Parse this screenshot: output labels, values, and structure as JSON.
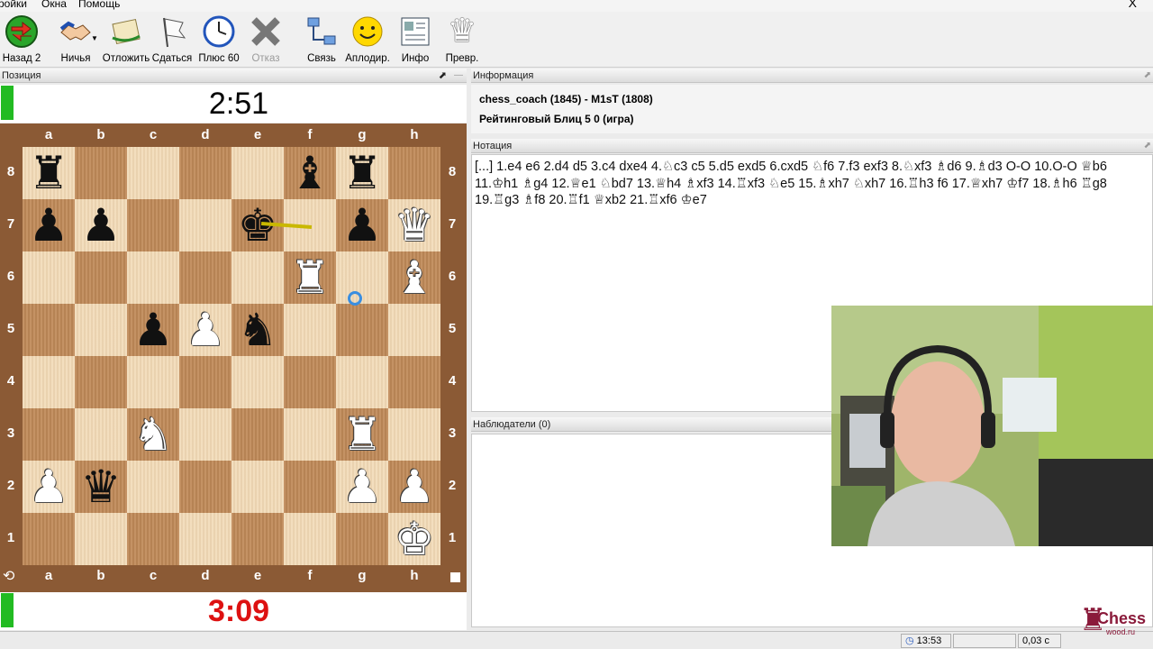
{
  "menu": {
    "items": [
      "ройки",
      "Окна",
      "Помощь"
    ],
    "close": "X"
  },
  "toolbar": {
    "buttons": [
      {
        "label": "Назад 2",
        "icon": "back-arrow-icon"
      },
      {
        "label": "Ничья",
        "icon": "handshake-icon"
      },
      {
        "label": "Отложить",
        "icon": "adjourn-scroll-icon"
      },
      {
        "label": "Сдаться",
        "icon": "white-flag-icon"
      },
      {
        "label": "Плюс 60",
        "icon": "clock-icon"
      },
      {
        "label": "Отказ",
        "icon": "decline-x-icon",
        "disabled": true
      },
      {
        "label": "Связь",
        "icon": "network-icon"
      },
      {
        "label": "Аплодир.",
        "icon": "smiley-icon"
      },
      {
        "label": "Инфо",
        "icon": "info-card-icon"
      },
      {
        "label": "Превр.",
        "icon": "promotion-queen-icon"
      }
    ]
  },
  "position_panel": {
    "title": "Позиция",
    "top_clock": "2:51",
    "bottom_clock": "3:09",
    "bottom_clock_color": "#dd1111"
  },
  "board": {
    "files": [
      "a",
      "b",
      "c",
      "d",
      "e",
      "f",
      "g",
      "h"
    ],
    "ranks": [
      "8",
      "7",
      "6",
      "5",
      "4",
      "3",
      "2",
      "1"
    ],
    "pieces": [
      {
        "sq": "a8",
        "p": "♜",
        "c": "b"
      },
      {
        "sq": "f8",
        "p": "♝",
        "c": "b"
      },
      {
        "sq": "g8",
        "p": "♜",
        "c": "b"
      },
      {
        "sq": "a7",
        "p": "♟",
        "c": "b"
      },
      {
        "sq": "b7",
        "p": "♟",
        "c": "b"
      },
      {
        "sq": "e7",
        "p": "♚",
        "c": "b"
      },
      {
        "sq": "g7",
        "p": "♟",
        "c": "b"
      },
      {
        "sq": "h7",
        "p": "♛",
        "c": "w"
      },
      {
        "sq": "f6",
        "p": "♜",
        "c": "w"
      },
      {
        "sq": "h6",
        "p": "♝",
        "c": "w"
      },
      {
        "sq": "c5",
        "p": "♟",
        "c": "b"
      },
      {
        "sq": "d5",
        "p": "♟",
        "c": "w"
      },
      {
        "sq": "e5",
        "p": "♞",
        "c": "b"
      },
      {
        "sq": "c3",
        "p": "♞",
        "c": "w"
      },
      {
        "sq": "g3",
        "p": "♜",
        "c": "w"
      },
      {
        "sq": "a2",
        "p": "♟",
        "c": "w"
      },
      {
        "sq": "b2",
        "p": "♛",
        "c": "b"
      },
      {
        "sq": "g2",
        "p": "♟",
        "c": "w"
      },
      {
        "sq": "h2",
        "p": "♟",
        "c": "w"
      },
      {
        "sq": "h1",
        "p": "♚",
        "c": "w"
      }
    ]
  },
  "info_panel": {
    "title": "Информация",
    "players": "chess_coach (1845) - M1sT (1808)",
    "game_type": "Рейтинговый Блиц 5 0  (игра)"
  },
  "notation_panel": {
    "title": "Нотация",
    "text": "[...] 1.e4 e6 2.d4 d5 3.c4 dxe4 4.♘c3 c5 5.d5 exd5 6.cxd5 ♘f6 7.f3 exf3 8.♘xf3 ♗d6 9.♗d3 O-O 10.O-O ♕b6 11.♔h1 ♗g4 12.♕e1 ♘bd7 13.♕h4 ♗xf3 14.♖xf3 ♘e5 15.♗xh7 ♘xh7 16.♖h3 f6 17.♕xh7 ♔f7 18.♗h6 ♖g8 19.♖g3 ♗f8 20.♖f1 ♕xb2 21.♖xf6 ♔e7"
  },
  "observers_panel": {
    "title": "Наблюдатели (0)"
  },
  "status": {
    "time": "13:53",
    "lag": "0,03 с"
  },
  "logo": {
    "text": "Chess",
    "subtext": "wood.ru"
  }
}
